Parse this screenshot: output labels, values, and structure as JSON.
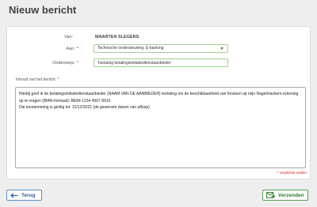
{
  "page": {
    "title": "Nieuw bericht"
  },
  "form": {
    "from_label": "Van:",
    "from_value": "MAARTEN SLEGERS",
    "to_label": "Aan:",
    "to_value": "Technische ondersteuning: E-banking",
    "subject_label": "Onderwerp:",
    "subject_value": "Toelating betalingsinitiatiedienstaanbieder",
    "body_label": "Inhoud van het bericht:",
    "body_value": "Hierbij geef ik de betalingsinitiatiedienstaanbieder (NAAM VAN DE AANBIEDER) toelating om de beschikbaarheid van fondsen op mijn Nagelmackers-rekening op te vragen (IBAN-formaat): BE84 1234 4567 8910\nDie toestemming is geldig tot: 31/12/2021 (de gewenste datum van afloop)",
    "required_note": "Verplichte velden",
    "required_mark": "*"
  },
  "buttons": {
    "back_label": "Terug",
    "send_label": "Verzenden"
  },
  "colors": {
    "required": "#cc1f1f",
    "back_accent": "#2d5f99",
    "send_accent": "#2e7d2e"
  },
  "icons": {
    "back": "arrow-left-icon",
    "send": "send-icon",
    "dropdown": "chevron-down-icon"
  }
}
